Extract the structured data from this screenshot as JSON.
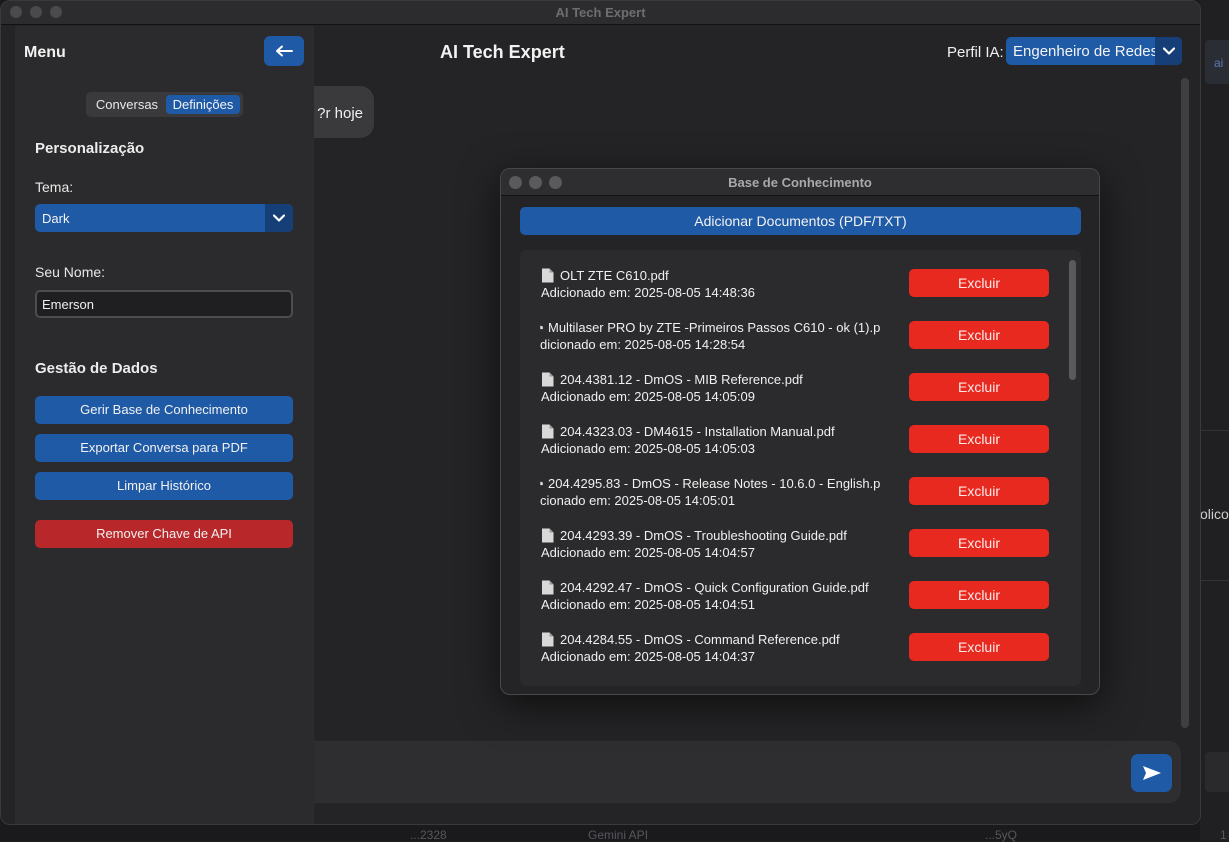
{
  "window": {
    "title": "AI Tech Expert"
  },
  "header": {
    "title": "AI Tech Expert",
    "profile_label": "Perfil IA:",
    "profile_value": "Engenheiro de Redes"
  },
  "chat": {
    "bubble_text": "r hoje?"
  },
  "sidebar": {
    "title": "Menu",
    "tabs": [
      {
        "label": "Conversas"
      },
      {
        "label": "Definições"
      }
    ],
    "personalization_title": "Personalização",
    "theme_label": "Tema:",
    "theme_value": "Dark",
    "name_label": "Seu Nome:",
    "name_value": "Emerson",
    "data_title": "Gestão de Dados",
    "buttons": {
      "manage_kb": "Gerir Base de Conhecimento",
      "export_pdf": "Exportar Conversa para PDF",
      "clear_history": "Limpar Histórico",
      "remove_api_key": "Remover Chave de API"
    }
  },
  "kb": {
    "title": "Base de Conhecimento",
    "add_label": "Adicionar Documentos (PDF/TXT)",
    "delete_label": "Excluir",
    "documents": [
      {
        "name": "OLT ZTE C610.pdf",
        "added": "Adicionado em: 2025-08-05 14:48:36"
      },
      {
        "name": "Multilaser PRO by ZTE -Primeiros Passos C610 - ok (1).p",
        "added": "dicionado em: 2025-08-05 14:28:54"
      },
      {
        "name": "204.4381.12 - DmOS - MIB Reference.pdf",
        "added": "Adicionado em: 2025-08-05 14:05:09"
      },
      {
        "name": "204.4323.03 - DM4615 - Installation Manual.pdf",
        "added": "Adicionado em: 2025-08-05 14:05:03"
      },
      {
        "name": "204.4295.83 - DmOS - Release Notes - 10.6.0 - English.p",
        "added": "cionado em: 2025-08-05 14:05:01"
      },
      {
        "name": "204.4293.39 - DmOS - Troubleshooting Guide.pdf",
        "added": "Adicionado em: 2025-08-05 14:04:57"
      },
      {
        "name": "204.4292.47 - DmOS - Quick Configuration Guide.pdf",
        "added": "Adicionado em: 2025-08-05 14:04:51"
      },
      {
        "name": "204.4284.55 - DmOS - Command Reference.pdf",
        "added": "Adicionado em: 2025-08-05 14:04:37"
      }
    ]
  },
  "background": {
    "right_tag": "ai",
    "right_text": "olico",
    "bottom_texts": [
      "...2328",
      "Gemini API",
      "...5yQ",
      "1"
    ]
  },
  "colors": {
    "accent": "#1f5aa6",
    "danger": "#e8291f",
    "sidebar_danger": "#b8272a"
  }
}
